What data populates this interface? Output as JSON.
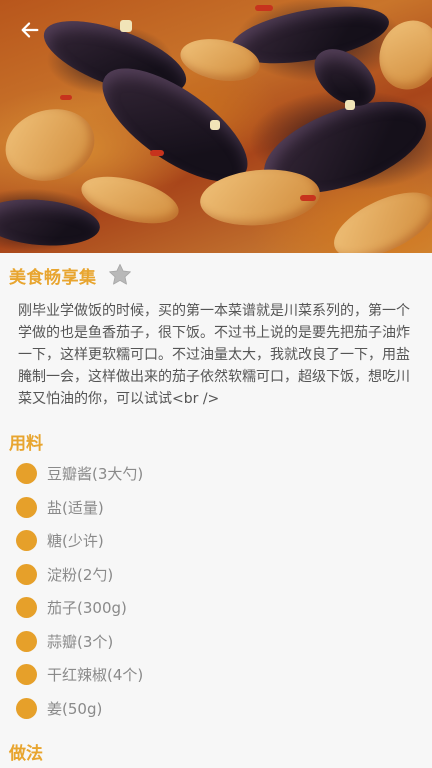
{
  "header": {
    "back_icon": "arrow-left-icon",
    "favorite_icon": "star-icon"
  },
  "recipe": {
    "title": "美食畅享集",
    "intro": "刚毕业学做饭的时候，买的第一本菜谱就是川菜系列的，第一个学做的也是鱼香茄子，很下饭。不过书上说的是要先把茄子油炸一下，这样更软糯可口。不过油量太大，我就改良了一下，用盐腌制一会，这样做出来的茄子依然软糯可口，超级下饭，想吃川菜又怕油的你，可以试试<br />"
  },
  "ingredients_section": {
    "title": "用料",
    "items": [
      {
        "label": "豆瓣酱(3大勺)"
      },
      {
        "label": "盐(适量)"
      },
      {
        "label": "糖(少许)"
      },
      {
        "label": "淀粉(2勺)"
      },
      {
        "label": "茄子(300g)"
      },
      {
        "label": "蒜瓣(3个)"
      },
      {
        "label": "干红辣椒(4个)"
      },
      {
        "label": "姜(50g)"
      }
    ]
  },
  "method_section": {
    "title": "做法"
  },
  "colors": {
    "accent": "#e8a52f",
    "dot": "#e6a02a",
    "text": "#555555",
    "muted": "#8a8a8a",
    "background": "#f7f7f7"
  }
}
